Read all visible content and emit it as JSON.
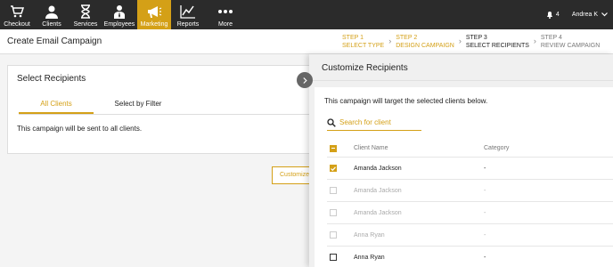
{
  "nav": {
    "items": [
      {
        "label": "Checkout",
        "icon": "cart-icon",
        "active": false
      },
      {
        "label": "Clients",
        "icon": "clients-icon",
        "active": false
      },
      {
        "label": "Services",
        "icon": "hourglass-icon",
        "active": false
      },
      {
        "label": "Employees",
        "icon": "employees-icon",
        "active": false
      },
      {
        "label": "Marketing",
        "icon": "megaphone-icon",
        "active": true
      },
      {
        "label": "Reports",
        "icon": "chart-icon",
        "active": false
      },
      {
        "label": "More",
        "icon": "dots-icon",
        "active": false
      }
    ],
    "notification_count": "4",
    "user_name": "Andrea K"
  },
  "header": {
    "title": "Create Email Campaign",
    "steps": [
      {
        "line1": "STEP 1",
        "line2": "SELECT TYPE",
        "state": "done"
      },
      {
        "line1": "STEP 2",
        "line2": "DESIGN CAMPAIGN",
        "state": "done"
      },
      {
        "line1": "STEP 3",
        "line2": "SELECT RECIPIENTS",
        "state": "current"
      },
      {
        "line1": "STEP 4",
        "line2": "REVIEW CAMPAIGN",
        "state": "future"
      }
    ]
  },
  "left": {
    "title": "Select Recipients",
    "tabs": [
      "All Clients",
      "Select by Filter"
    ],
    "message": "This campaign will be sent to all clients.",
    "customize_label": "Customize"
  },
  "drawer": {
    "title": "Customize Recipients",
    "message": "This campaign will target the selected clients below.",
    "search_placeholder": "Search for client",
    "columns": [
      "Client Name",
      "Category"
    ],
    "rows": [
      {
        "name": "Amanda Jackson",
        "category": "-",
        "state": "checked"
      },
      {
        "name": "Amanda Jackson",
        "category": "-",
        "state": "disabled"
      },
      {
        "name": "Amanda Jackson",
        "category": "-",
        "state": "disabled"
      },
      {
        "name": "Anna Ryan",
        "category": "-",
        "state": "disabled"
      },
      {
        "name": "Anna Ryan",
        "category": "-",
        "state": "unchecked"
      }
    ]
  },
  "colors": {
    "accent": "#d4a017",
    "nav_bg": "#2b2b2b"
  }
}
